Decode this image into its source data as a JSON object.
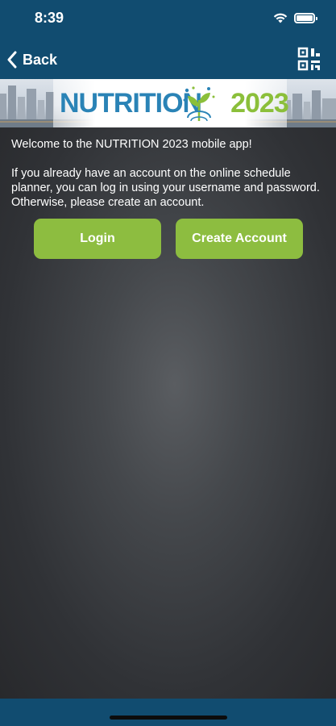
{
  "status_bar": {
    "time": "8:39",
    "wifi_icon": "wifi-icon",
    "battery_icon": "battery-icon"
  },
  "nav": {
    "back_label": "Back",
    "back_icon": "chevron-left-icon",
    "qr_icon": "qr-code-scan-icon"
  },
  "banner": {
    "word": "NUTRITION",
    "year": "2023",
    "logo_icon": "plant-globe-logo"
  },
  "content": {
    "welcome_text": "Welcome to the NUTRITION 2023 mobile app!",
    "intro_text": "If you already have an account on the online schedule planner, you can log in using your username and password. Otherwise, please create an account.",
    "login_label": "Login",
    "create_account_label": "Create Account"
  },
  "colors": {
    "header": "#114c70",
    "button": "#8dbd40",
    "title_blue": "#2a83b6",
    "title_green": "#8bbf3a"
  }
}
